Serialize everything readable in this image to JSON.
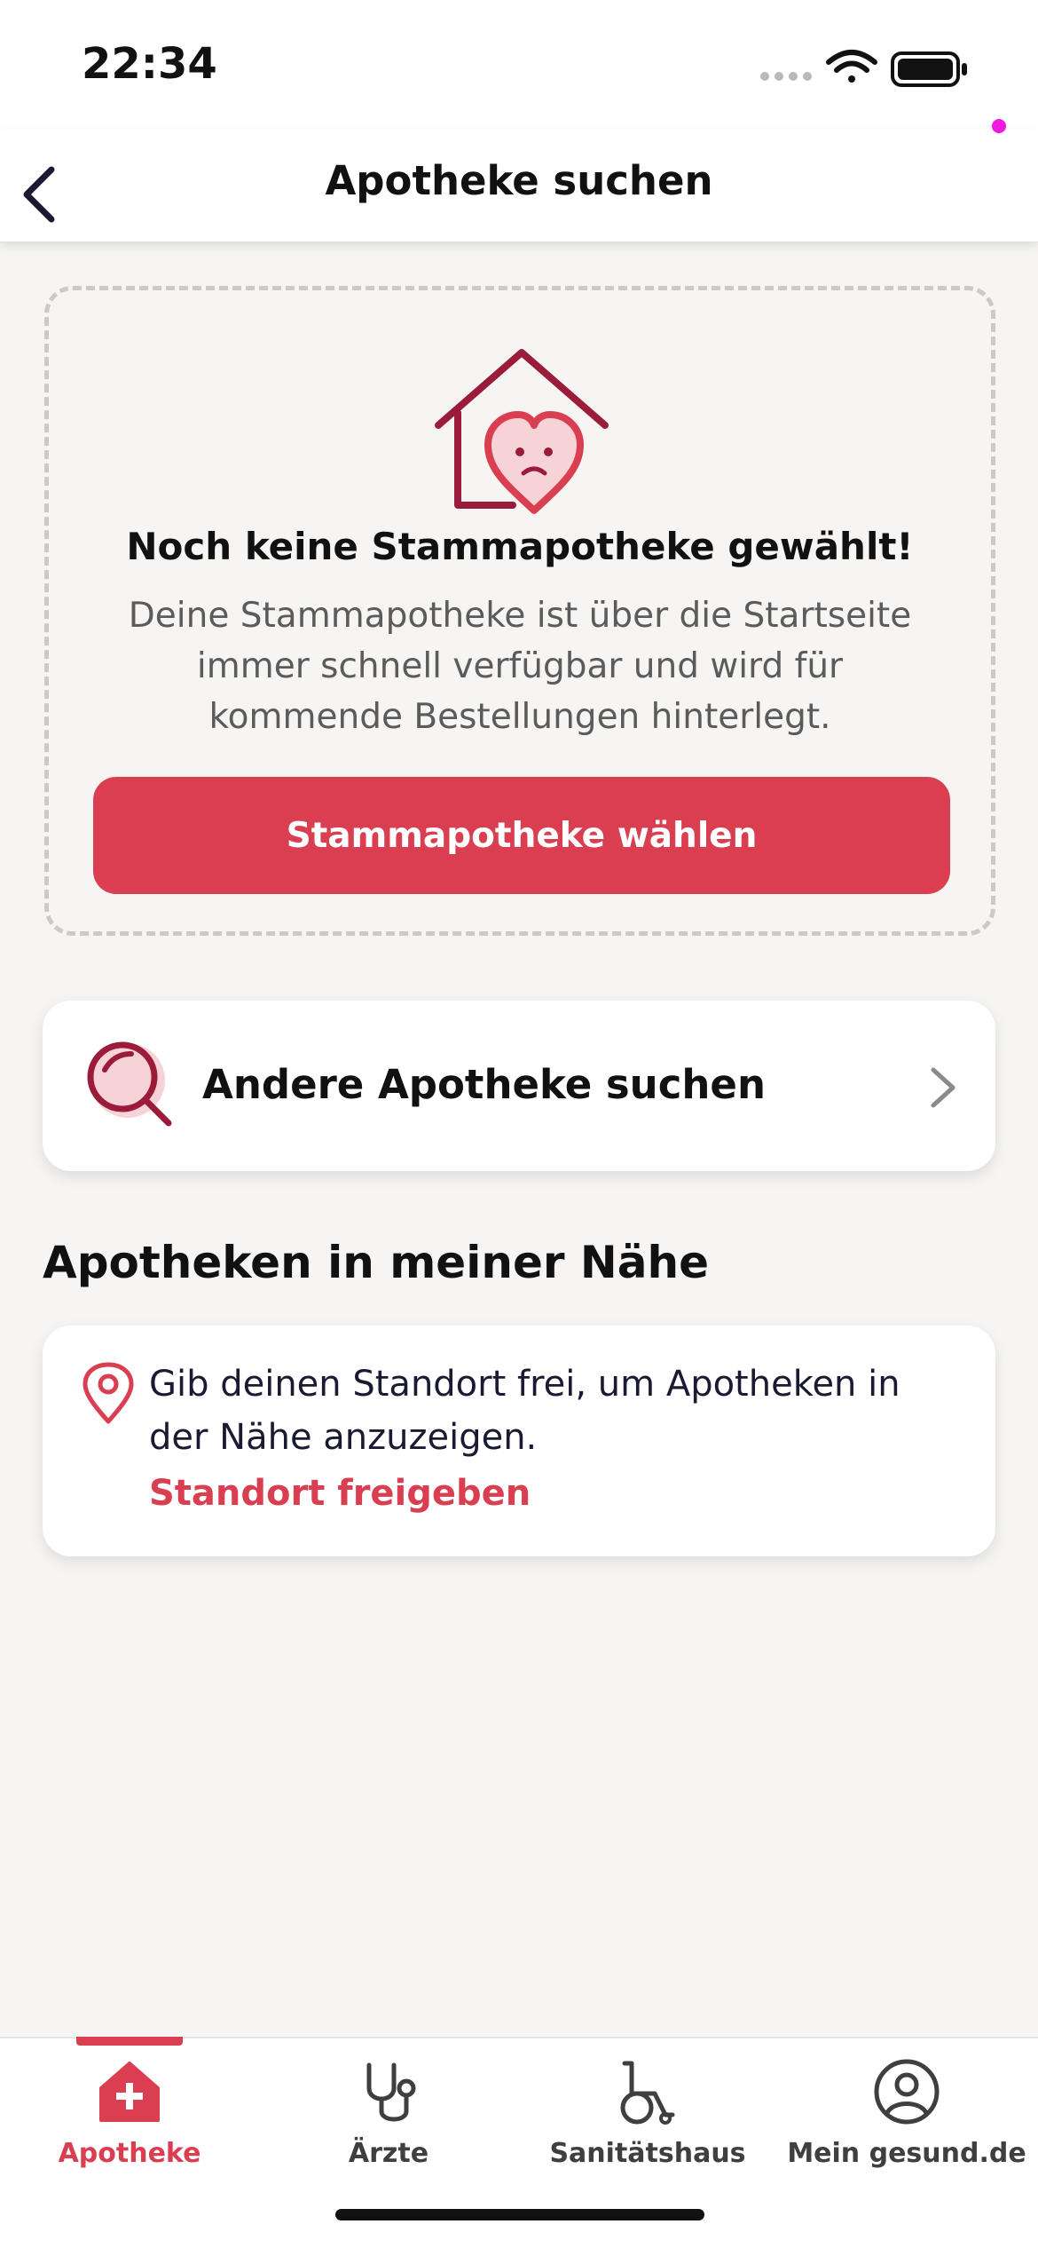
{
  "status_bar": {
    "time": "22:34",
    "icons": [
      "signal-icon",
      "wifi-icon",
      "battery-icon"
    ]
  },
  "nav": {
    "title": "Apotheke suchen",
    "back_icon": "chevron-left-icon"
  },
  "empty_state": {
    "illustration": "sad-heart-house-icon",
    "title": "Noch keine Stammapotheke gewählt!",
    "text": "Deine Stammapotheke ist über die Startseite immer schnell verfügbar und wird für kommende Bestellungen hinterlegt.",
    "button_label": "Stammapotheke wählen"
  },
  "search_card": {
    "icon": "search-icon",
    "label": "Andere Apotheke suchen",
    "chevron": "chevron-right-icon"
  },
  "nearby": {
    "section_title": "Apotheken in meiner Nähe",
    "icon": "location-pin-icon",
    "text": "Gib deinen Standort frei, um Apotheken in der Nähe anzuzeigen.",
    "link_label": "Standort freigeben"
  },
  "tab_bar": {
    "tabs": [
      {
        "label": "Apotheke",
        "icon": "pharmacy-house-icon",
        "active": true
      },
      {
        "label": "Ärzte",
        "icon": "stethoscope-icon",
        "active": false
      },
      {
        "label": "Sanitätshaus",
        "icon": "wheelchair-icon",
        "active": false
      },
      {
        "label": "Mein gesund.de",
        "icon": "profile-icon",
        "active": false
      }
    ]
  },
  "colors": {
    "accent": "#d93f50",
    "icon_dark": "#9b1b3b",
    "background": "#f6f5f3",
    "card": "#ffffff",
    "dot": "#f118e0"
  }
}
